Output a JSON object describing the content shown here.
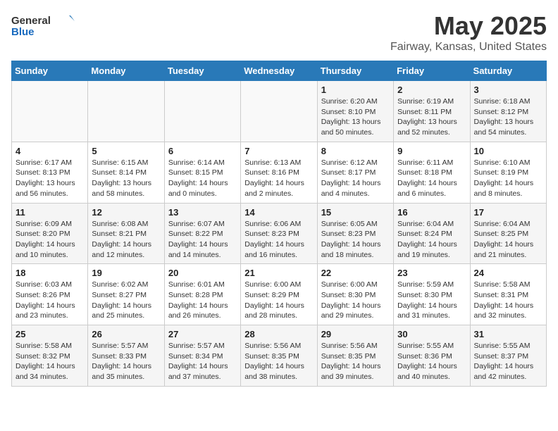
{
  "logo": {
    "text_general": "General",
    "text_blue": "Blue"
  },
  "title": "May 2025",
  "subtitle": "Fairway, Kansas, United States",
  "weekdays": [
    "Sunday",
    "Monday",
    "Tuesday",
    "Wednesday",
    "Thursday",
    "Friday",
    "Saturday"
  ],
  "weeks": [
    [
      {
        "day": "",
        "sunrise": "",
        "sunset": "",
        "daylight": ""
      },
      {
        "day": "",
        "sunrise": "",
        "sunset": "",
        "daylight": ""
      },
      {
        "day": "",
        "sunrise": "",
        "sunset": "",
        "daylight": ""
      },
      {
        "day": "",
        "sunrise": "",
        "sunset": "",
        "daylight": ""
      },
      {
        "day": "1",
        "sunrise": "Sunrise: 6:20 AM",
        "sunset": "Sunset: 8:10 PM",
        "daylight": "Daylight: 13 hours and 50 minutes."
      },
      {
        "day": "2",
        "sunrise": "Sunrise: 6:19 AM",
        "sunset": "Sunset: 8:11 PM",
        "daylight": "Daylight: 13 hours and 52 minutes."
      },
      {
        "day": "3",
        "sunrise": "Sunrise: 6:18 AM",
        "sunset": "Sunset: 8:12 PM",
        "daylight": "Daylight: 13 hours and 54 minutes."
      }
    ],
    [
      {
        "day": "4",
        "sunrise": "Sunrise: 6:17 AM",
        "sunset": "Sunset: 8:13 PM",
        "daylight": "Daylight: 13 hours and 56 minutes."
      },
      {
        "day": "5",
        "sunrise": "Sunrise: 6:15 AM",
        "sunset": "Sunset: 8:14 PM",
        "daylight": "Daylight: 13 hours and 58 minutes."
      },
      {
        "day": "6",
        "sunrise": "Sunrise: 6:14 AM",
        "sunset": "Sunset: 8:15 PM",
        "daylight": "Daylight: 14 hours and 0 minutes."
      },
      {
        "day": "7",
        "sunrise": "Sunrise: 6:13 AM",
        "sunset": "Sunset: 8:16 PM",
        "daylight": "Daylight: 14 hours and 2 minutes."
      },
      {
        "day": "8",
        "sunrise": "Sunrise: 6:12 AM",
        "sunset": "Sunset: 8:17 PM",
        "daylight": "Daylight: 14 hours and 4 minutes."
      },
      {
        "day": "9",
        "sunrise": "Sunrise: 6:11 AM",
        "sunset": "Sunset: 8:18 PM",
        "daylight": "Daylight: 14 hours and 6 minutes."
      },
      {
        "day": "10",
        "sunrise": "Sunrise: 6:10 AM",
        "sunset": "Sunset: 8:19 PM",
        "daylight": "Daylight: 14 hours and 8 minutes."
      }
    ],
    [
      {
        "day": "11",
        "sunrise": "Sunrise: 6:09 AM",
        "sunset": "Sunset: 8:20 PM",
        "daylight": "Daylight: 14 hours and 10 minutes."
      },
      {
        "day": "12",
        "sunrise": "Sunrise: 6:08 AM",
        "sunset": "Sunset: 8:21 PM",
        "daylight": "Daylight: 14 hours and 12 minutes."
      },
      {
        "day": "13",
        "sunrise": "Sunrise: 6:07 AM",
        "sunset": "Sunset: 8:22 PM",
        "daylight": "Daylight: 14 hours and 14 minutes."
      },
      {
        "day": "14",
        "sunrise": "Sunrise: 6:06 AM",
        "sunset": "Sunset: 8:23 PM",
        "daylight": "Daylight: 14 hours and 16 minutes."
      },
      {
        "day": "15",
        "sunrise": "Sunrise: 6:05 AM",
        "sunset": "Sunset: 8:23 PM",
        "daylight": "Daylight: 14 hours and 18 minutes."
      },
      {
        "day": "16",
        "sunrise": "Sunrise: 6:04 AM",
        "sunset": "Sunset: 8:24 PM",
        "daylight": "Daylight: 14 hours and 19 minutes."
      },
      {
        "day": "17",
        "sunrise": "Sunrise: 6:04 AM",
        "sunset": "Sunset: 8:25 PM",
        "daylight": "Daylight: 14 hours and 21 minutes."
      }
    ],
    [
      {
        "day": "18",
        "sunrise": "Sunrise: 6:03 AM",
        "sunset": "Sunset: 8:26 PM",
        "daylight": "Daylight: 14 hours and 23 minutes."
      },
      {
        "day": "19",
        "sunrise": "Sunrise: 6:02 AM",
        "sunset": "Sunset: 8:27 PM",
        "daylight": "Daylight: 14 hours and 25 minutes."
      },
      {
        "day": "20",
        "sunrise": "Sunrise: 6:01 AM",
        "sunset": "Sunset: 8:28 PM",
        "daylight": "Daylight: 14 hours and 26 minutes."
      },
      {
        "day": "21",
        "sunrise": "Sunrise: 6:00 AM",
        "sunset": "Sunset: 8:29 PM",
        "daylight": "Daylight: 14 hours and 28 minutes."
      },
      {
        "day": "22",
        "sunrise": "Sunrise: 6:00 AM",
        "sunset": "Sunset: 8:30 PM",
        "daylight": "Daylight: 14 hours and 29 minutes."
      },
      {
        "day": "23",
        "sunrise": "Sunrise: 5:59 AM",
        "sunset": "Sunset: 8:30 PM",
        "daylight": "Daylight: 14 hours and 31 minutes."
      },
      {
        "day": "24",
        "sunrise": "Sunrise: 5:58 AM",
        "sunset": "Sunset: 8:31 PM",
        "daylight": "Daylight: 14 hours and 32 minutes."
      }
    ],
    [
      {
        "day": "25",
        "sunrise": "Sunrise: 5:58 AM",
        "sunset": "Sunset: 8:32 PM",
        "daylight": "Daylight: 14 hours and 34 minutes."
      },
      {
        "day": "26",
        "sunrise": "Sunrise: 5:57 AM",
        "sunset": "Sunset: 8:33 PM",
        "daylight": "Daylight: 14 hours and 35 minutes."
      },
      {
        "day": "27",
        "sunrise": "Sunrise: 5:57 AM",
        "sunset": "Sunset: 8:34 PM",
        "daylight": "Daylight: 14 hours and 37 minutes."
      },
      {
        "day": "28",
        "sunrise": "Sunrise: 5:56 AM",
        "sunset": "Sunset: 8:35 PM",
        "daylight": "Daylight: 14 hours and 38 minutes."
      },
      {
        "day": "29",
        "sunrise": "Sunrise: 5:56 AM",
        "sunset": "Sunset: 8:35 PM",
        "daylight": "Daylight: 14 hours and 39 minutes."
      },
      {
        "day": "30",
        "sunrise": "Sunrise: 5:55 AM",
        "sunset": "Sunset: 8:36 PM",
        "daylight": "Daylight: 14 hours and 40 minutes."
      },
      {
        "day": "31",
        "sunrise": "Sunrise: 5:55 AM",
        "sunset": "Sunset: 8:37 PM",
        "daylight": "Daylight: 14 hours and 42 minutes."
      }
    ]
  ]
}
